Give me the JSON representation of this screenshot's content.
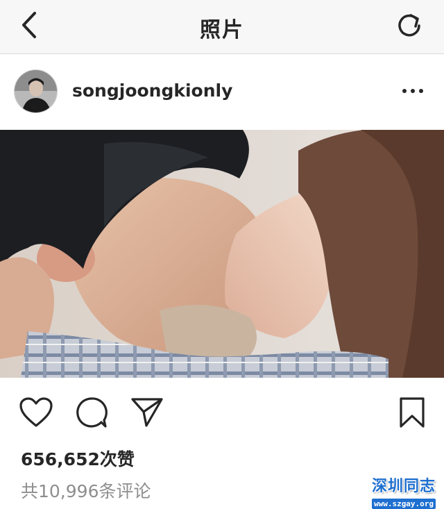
{
  "topbar": {
    "title": "照片",
    "back_icon": "chevron-left-icon",
    "refresh_icon": "refresh-icon"
  },
  "post": {
    "username": "songjoongkionly",
    "more_icon": "more-horizontal-icon",
    "photo_description": "photo",
    "likes_text": "656,652次赞",
    "comments_text": "共10,996条评论"
  },
  "actions": {
    "like_icon": "heart-icon",
    "comment_icon": "comment-bubble-icon",
    "share_icon": "send-icon",
    "save_icon": "bookmark-icon"
  },
  "watermark": {
    "text": "深圳同志",
    "url": "www.szgay.org"
  },
  "colors": {
    "text": "#262626",
    "muted": "#8e8e8e",
    "topbar_bg": "#f7f7f7",
    "watermark_blue": "#1e6fd0"
  }
}
